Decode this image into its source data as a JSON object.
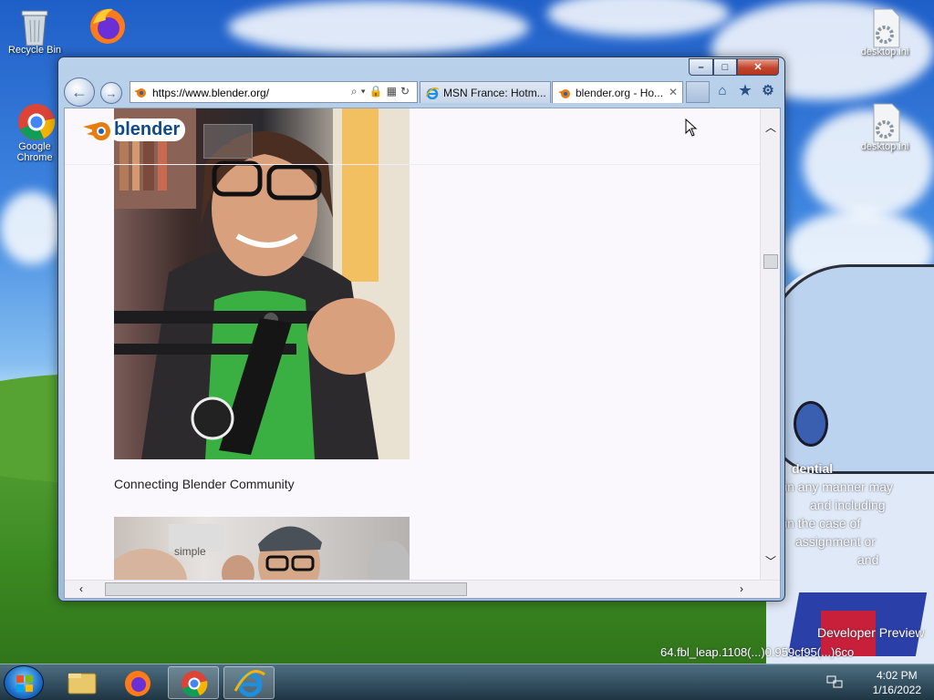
{
  "desktop": {
    "icons": [
      {
        "label": "Recycle Bin"
      },
      {
        "label": ""
      },
      {
        "label": "Google Chrome"
      },
      {
        "label": "desktop.ini"
      },
      {
        "label": "desktop.ini"
      }
    ],
    "overlay_lines": [
      "dential",
      "in any manner may",
      "and including",
      "in the case of",
      "assignment or",
      "and",
      "Developer Preview",
      "64.fbl_leap.1108(...)0.959cf95(...)6co"
    ]
  },
  "browser": {
    "address_url": "https://www.blender.org/",
    "tabs": [
      {
        "label": "MSN France: Hotm...",
        "active": false
      },
      {
        "label": "blender.org - Ho...",
        "active": true
      }
    ],
    "caption_buttons": {
      "minimize": "–",
      "maximize": "□",
      "close": "✕"
    }
  },
  "page": {
    "logo_text": "blender",
    "menu_icon": "≡",
    "caption": "Connecting Blender Community",
    "photo2_text": "simple"
  },
  "taskbar": {
    "time": "4:02 PM",
    "date": "1/16/2022",
    "pinned": [
      "explorer-icon",
      "firefox-icon",
      "chrome-icon",
      "ie-icon"
    ]
  }
}
